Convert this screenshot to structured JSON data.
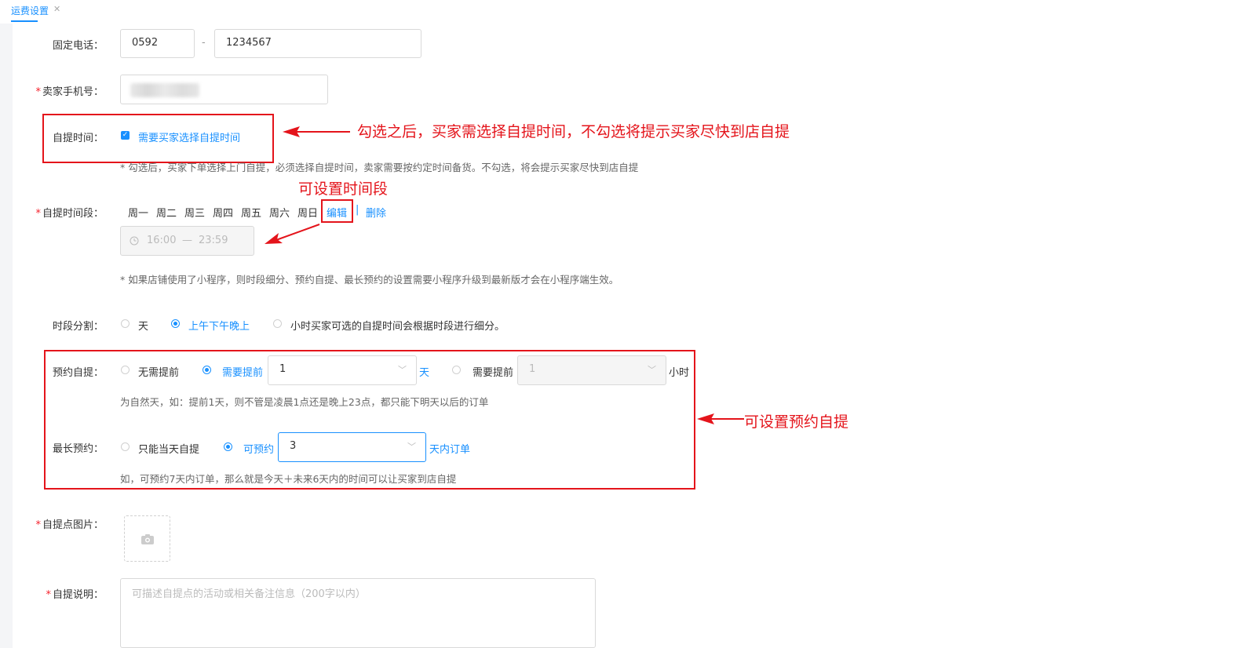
{
  "tab": {
    "title": "运费设置",
    "close": "✕"
  },
  "fields": {
    "phone_label": "固定电话：",
    "phone_area": "0592",
    "phone_dash": "-",
    "phone_number": "1234567",
    "mobile_label": "卖家手机号：",
    "pickup_time_label": "自提时间：",
    "pickup_time_checkbox": "需要买家选择自提时间",
    "pickup_time_hint": "* 勾选后，买家下单选择上门自提，必须选择自提时间，卖家需要按约定时间备货。不勾选，将会提示买家尽快到店自提",
    "period_label": "自提时间段：",
    "weekdays": [
      "周一",
      "周二",
      "周三",
      "周四",
      "周五",
      "周六",
      "周日"
    ],
    "edit_link": "编辑",
    "link_sep": "|",
    "delete_link": "删除",
    "time_start": "16:00",
    "time_dash": "—",
    "time_end": "23:59",
    "period_hint": "* 如果店铺使用了小程序，则时段细分、预约自提、最长预约的设置需要小程序升级到最新版才会在小程序端生效。",
    "split_label": "时段分割：",
    "split_opt1": "天",
    "split_opt2": "上午下午晚上",
    "split_opt3": "小时买家可选的自提时间会根据时段进行细分。",
    "reserve_label": "预约自提：",
    "reserve_opt1": "无需提前",
    "reserve_opt2": "需要提前",
    "reserve_days_value": "1",
    "reserve_days_unit": "天",
    "reserve_opt3": "需要提前",
    "reserve_hours_value": "1",
    "reserve_hours_unit": "小时",
    "reserve_hint": "为自然天，如：提前1天，则不管是凌晨1点还是晚上23点，都只能下明天以后的订单",
    "max_label": "最长预约：",
    "max_opt1": "只能当天自提",
    "max_opt2": "可预约",
    "max_value": "3",
    "max_unit": "天内订单",
    "max_hint": "如，可预约7天内订单，那么就是今天＋未来6天内的时间可以让买家到店自提",
    "image_label": "自提点图片：",
    "desc_label": "自提说明：",
    "desc_placeholder": "可描述自提点的活动或相关备注信息（200字以内）",
    "required_mark": "*"
  },
  "annotations": {
    "a1": "勾选之后，买家需选择自提时间，不勾选将提示买家尽快到店自提",
    "a2": "可设置时间段",
    "a3": "可设置预约自提"
  },
  "colors": {
    "accent": "#1890ff",
    "annotation": "#e4141b",
    "required": "#f5222d"
  },
  "icons": {
    "clock": "clock-icon",
    "camera": "camera-icon",
    "chevron": "chevron-down-icon",
    "check": "check-icon",
    "close": "close-icon",
    "arrow": "arrow-left-icon"
  }
}
